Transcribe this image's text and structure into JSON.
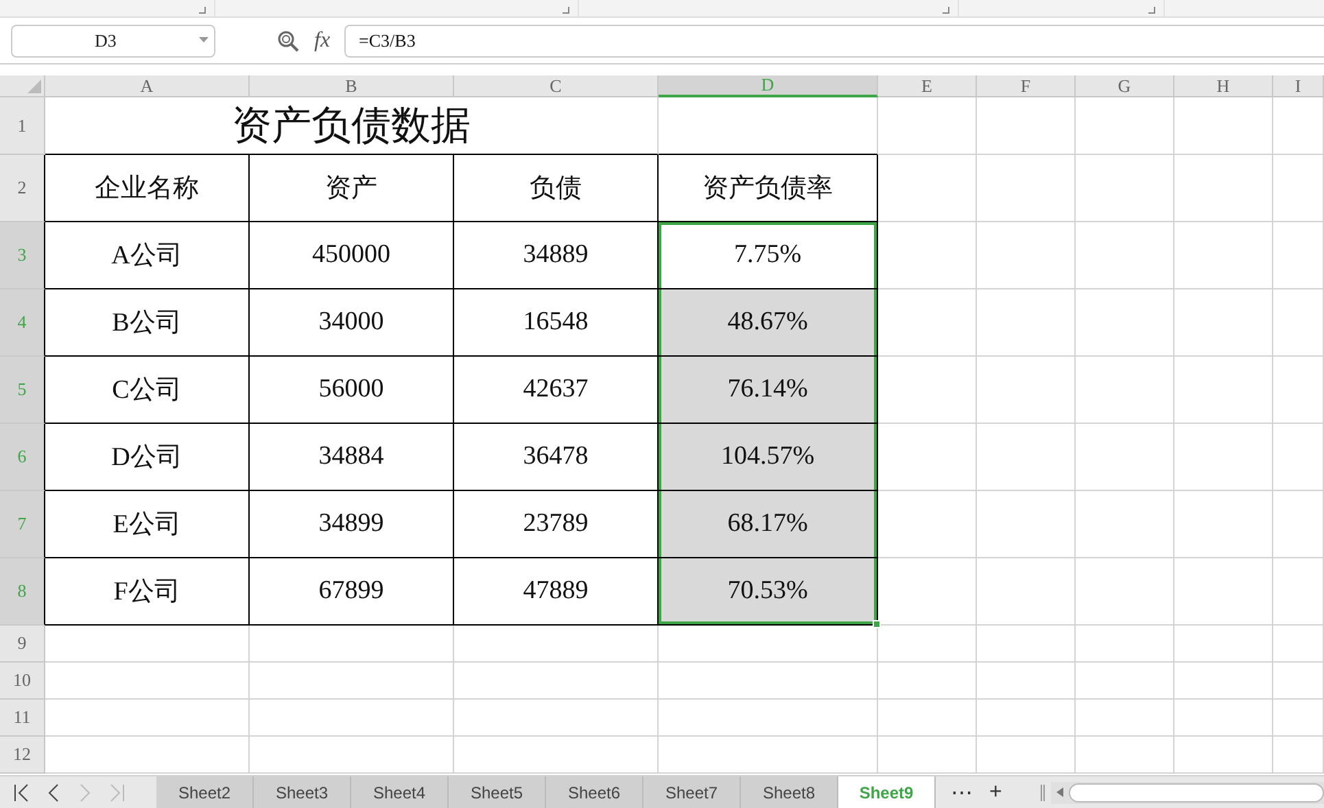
{
  "formula_bar": {
    "name_box": "D3",
    "fx_label": "fx",
    "formula": "=C3/B3"
  },
  "columns": [
    {
      "label": "A",
      "selected": false
    },
    {
      "label": "B",
      "selected": false
    },
    {
      "label": "C",
      "selected": false
    },
    {
      "label": "D",
      "selected": true
    },
    {
      "label": "E",
      "selected": false
    },
    {
      "label": "F",
      "selected": false
    },
    {
      "label": "G",
      "selected": false
    },
    {
      "label": "H",
      "selected": false
    },
    {
      "label": "I",
      "selected": false
    }
  ],
  "title_row": {
    "number": "1",
    "title": "资产负债数据"
  },
  "header_row": {
    "number": "2",
    "cells": [
      "企业名称",
      "资产",
      "负债",
      "资产负债率"
    ]
  },
  "rows": [
    {
      "number": "3",
      "selected": true,
      "active": true,
      "cells": [
        "A公司",
        "450000",
        "34889",
        "7.75%"
      ]
    },
    {
      "number": "4",
      "selected": true,
      "active": false,
      "cells": [
        "B公司",
        "34000",
        "16548",
        "48.67%"
      ]
    },
    {
      "number": "5",
      "selected": true,
      "active": false,
      "cells": [
        "C公司",
        "56000",
        "42637",
        "76.14%"
      ]
    },
    {
      "number": "6",
      "selected": true,
      "active": false,
      "cells": [
        "D公司",
        "34884",
        "36478",
        "104.57%"
      ]
    },
    {
      "number": "7",
      "selected": true,
      "active": false,
      "cells": [
        "E公司",
        "34899",
        "23789",
        "68.17%"
      ]
    },
    {
      "number": "8",
      "selected": true,
      "active": false,
      "cells": [
        "F公司",
        "67899",
        "47889",
        "70.53%"
      ]
    }
  ],
  "empty_rows": [
    "9",
    "10",
    "11",
    "12"
  ],
  "sheet_tabs": [
    {
      "label": "Sheet2",
      "selected": false
    },
    {
      "label": "Sheet3",
      "selected": false
    },
    {
      "label": "Sheet4",
      "selected": false
    },
    {
      "label": "Sheet5",
      "selected": false
    },
    {
      "label": "Sheet6",
      "selected": false
    },
    {
      "label": "Sheet7",
      "selected": false
    },
    {
      "label": "Sheet8",
      "selected": false
    },
    {
      "label": "Sheet9",
      "selected": true
    }
  ],
  "tab_more": "⋯",
  "tab_add": "+"
}
